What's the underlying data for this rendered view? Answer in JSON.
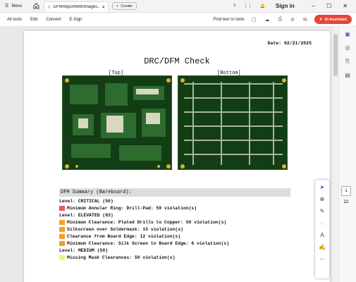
{
  "titlebar": {
    "menu_label": "Menu",
    "tab_title": "DFMReportWithImages...",
    "create_label": "Create",
    "signin_label": "Sign in"
  },
  "toolbar": {
    "items": [
      "All tools",
      "Edit",
      "Convert",
      "E-Sign"
    ],
    "find_label": "Find text or tools",
    "ai_label": "AI Assistant"
  },
  "document": {
    "date": "Date: 02/21/2025",
    "title": "DRC/DFM Check",
    "top_label": "[Top]",
    "bottom_label": "[Bottom]",
    "summary_title": "DFM Summary (Bareboard):",
    "summary_rows": [
      {
        "kind": "level",
        "text": "Level: CRITICAL (50)"
      },
      {
        "kind": "item",
        "color": "#e8585a",
        "text": "Minimum Annular Ring: Drill-Pad: 50 violation(s)"
      },
      {
        "kind": "level",
        "text": "Level: ELEVATED (83)"
      },
      {
        "kind": "item",
        "color": "#f2a12a",
        "text": "Minimum Clearance: Plated Drills to Copper: 50 violation(s)"
      },
      {
        "kind": "item",
        "color": "#f2a12a",
        "text": "Silkscreen over Soldermask: 15 violation(s)"
      },
      {
        "kind": "item",
        "color": "#f2a12a",
        "text": "Clearance from Board Edge: 12 violation(s)"
      },
      {
        "kind": "item",
        "color": "#f2a12a",
        "text": "Minimum Clearance: Silk Screen to Board Edge: 6 violation(s)"
      },
      {
        "kind": "level",
        "text": "Level: MEDIUM (50)"
      },
      {
        "kind": "item",
        "color": "#f6f07a",
        "text": "Missing Mask Clearances: 50 violation(s)"
      }
    ]
  },
  "pager": {
    "current": "1",
    "total": "22"
  }
}
